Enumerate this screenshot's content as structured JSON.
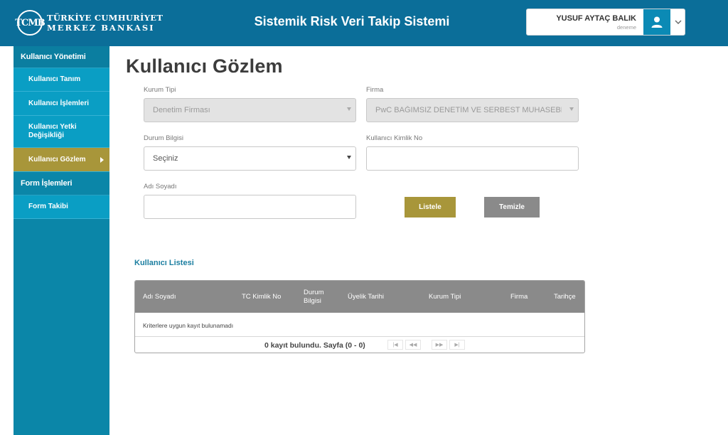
{
  "header": {
    "logo_mark": "TCMB",
    "logo_line1": "TÜRKİYE CUMHURİYET",
    "logo_line2": "MERKEZ BANKASI",
    "title": "Sistemik Risk Veri Takip Sistemi",
    "user_name": "YUSUF AYTAÇ BALIK",
    "user_sub": "deneme"
  },
  "sidebar": {
    "groups": [
      {
        "label": "Kullanıcı Yönetimi",
        "items": [
          "Kullanıcı Tanım",
          "Kullanıcı İşlemleri",
          "Kullanıcı Yetki Değişikliği",
          "Kullanıcı Gözlem"
        ]
      },
      {
        "label": "Form İşlemleri",
        "items": [
          "Form Takibi"
        ]
      }
    ],
    "active_item": "Kullanıcı Gözlem"
  },
  "page": {
    "title": "Kullanıcı Gözlem"
  },
  "form": {
    "kurum_tipi": {
      "label": "Kurum Tipi",
      "value": "Denetim Firması"
    },
    "firma": {
      "label": "Firma",
      "value": "PwC BAĞIMSIZ DENETİM VE SERBEST MUHASEBE"
    },
    "durum": {
      "label": "Durum Bilgisi",
      "value": "Seçiniz"
    },
    "kimlik": {
      "label": "Kullanıcı Kimlik No",
      "value": ""
    },
    "adi": {
      "label": "Adı Soyadı",
      "value": ""
    },
    "listele": "Listele",
    "temizle": "Temizle"
  },
  "list": {
    "title": "Kullanıcı Listesi",
    "columns": [
      "Adı Soyadı",
      "TC Kimlik No",
      "Durum Bilgisi",
      "Üyelik Tarihi",
      "Kurum Tipi",
      "Firma",
      "Tarihçe"
    ],
    "columns_split": {
      "durum_line1": "Durum",
      "durum_line2": "Bilgisi"
    },
    "empty_text": "Kriterlere uygun kayıt bulunamadı",
    "pager_text": "0 kayıt bulundu. Sayfa (0 - 0)",
    "pager_buttons": [
      "first",
      "prev",
      "next",
      "last"
    ]
  },
  "colors": {
    "header_bg": "#0b6e99",
    "sidebar_bg": "#0b86a8",
    "sidebar_item": "#0a9ec4",
    "active_item": "#a8963a",
    "listele_btn": "#a8963a",
    "temizle_btn": "#8a8a8a",
    "grid_header": "#8a8a8a"
  }
}
